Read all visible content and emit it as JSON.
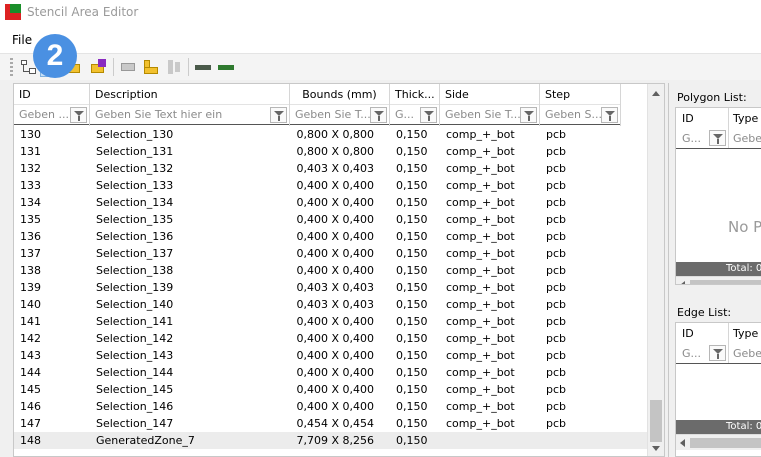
{
  "window": {
    "title": "Stencil Area Editor"
  },
  "menu": {
    "file": "File"
  },
  "callout": {
    "number": "2"
  },
  "toolbar": {
    "buttons": [
      "tree-view-icon",
      "open-folder-icon",
      "folder-arrow-icon",
      "folder-delete-icon",
      "layer-gray-icon",
      "shape-yellow-icon",
      "align-gray-icon",
      "component-dark-icon",
      "component-green-icon"
    ],
    "active": "open-folder-icon"
  },
  "grid": {
    "columns": [
      {
        "label": "ID",
        "filter": "Geben ..."
      },
      {
        "label": "Description",
        "filter": "Geben Sie Text hier ein"
      },
      {
        "label": "Bounds (mm)",
        "filter": "Geben Sie T..."
      },
      {
        "label": "Thick...",
        "filter": "G..."
      },
      {
        "label": "Side",
        "filter": "Geben Sie T..."
      },
      {
        "label": "Step",
        "filter": "Geben S..."
      }
    ],
    "rows": [
      [
        "130",
        "Selection_130",
        "0,800 X 0,800",
        "0,150",
        "comp_+_bot",
        "pcb"
      ],
      [
        "131",
        "Selection_131",
        "0,800 X 0,800",
        "0,150",
        "comp_+_bot",
        "pcb"
      ],
      [
        "132",
        "Selection_132",
        "0,403 X 0,403",
        "0,150",
        "comp_+_bot",
        "pcb"
      ],
      [
        "133",
        "Selection_133",
        "0,400 X 0,400",
        "0,150",
        "comp_+_bot",
        "pcb"
      ],
      [
        "134",
        "Selection_134",
        "0,400 X 0,400",
        "0,150",
        "comp_+_bot",
        "pcb"
      ],
      [
        "135",
        "Selection_135",
        "0,400 X 0,400",
        "0,150",
        "comp_+_bot",
        "pcb"
      ],
      [
        "136",
        "Selection_136",
        "0,400 X 0,400",
        "0,150",
        "comp_+_bot",
        "pcb"
      ],
      [
        "137",
        "Selection_137",
        "0,400 X 0,400",
        "0,150",
        "comp_+_bot",
        "pcb"
      ],
      [
        "138",
        "Selection_138",
        "0,400 X 0,400",
        "0,150",
        "comp_+_bot",
        "pcb"
      ],
      [
        "139",
        "Selection_139",
        "0,403 X 0,403",
        "0,150",
        "comp_+_bot",
        "pcb"
      ],
      [
        "140",
        "Selection_140",
        "0,403 X 0,403",
        "0,150",
        "comp_+_bot",
        "pcb"
      ],
      [
        "141",
        "Selection_141",
        "0,400 X 0,400",
        "0,150",
        "comp_+_bot",
        "pcb"
      ],
      [
        "142",
        "Selection_142",
        "0,400 X 0,400",
        "0,150",
        "comp_+_bot",
        "pcb"
      ],
      [
        "143",
        "Selection_143",
        "0,400 X 0,400",
        "0,150",
        "comp_+_bot",
        "pcb"
      ],
      [
        "144",
        "Selection_144",
        "0,400 X 0,400",
        "0,150",
        "comp_+_bot",
        "pcb"
      ],
      [
        "145",
        "Selection_145",
        "0,400 X 0,400",
        "0,150",
        "comp_+_bot",
        "pcb"
      ],
      [
        "146",
        "Selection_146",
        "0,400 X 0,400",
        "0,150",
        "comp_+_bot",
        "pcb"
      ],
      [
        "147",
        "Selection_147",
        "0,454 X 0,454",
        "0,150",
        "comp_+_bot",
        "pcb"
      ],
      [
        "148",
        "GeneratedZone_7",
        "7,709 X 8,256",
        "0,150",
        "",
        ""
      ]
    ]
  },
  "polygon_list": {
    "title": "Polygon List:",
    "columns": [
      {
        "label": "ID",
        "filter": "G..."
      },
      {
        "label": "Type",
        "filter": "Geben"
      }
    ],
    "empty": "No P",
    "total": "Total: 0"
  },
  "edge_list": {
    "title": "Edge List:",
    "columns": [
      {
        "label": "ID",
        "filter": "G..."
      },
      {
        "label": "Type",
        "filter": "Geben"
      }
    ],
    "total": "Total: 0"
  }
}
